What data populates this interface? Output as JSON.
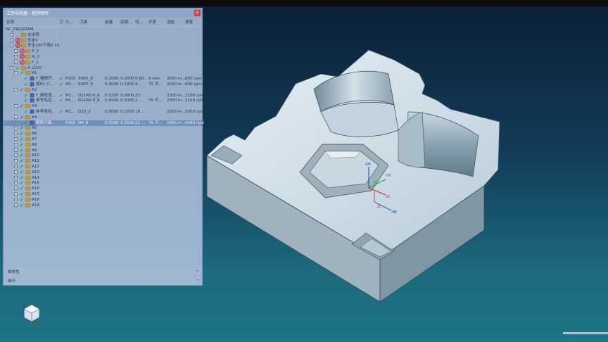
{
  "panel": {
    "title": "工序导航器 - 程序顺序",
    "columns": [
      "名称",
      "刀",
      "几...",
      "刀具",
      "余量",
      "底面...",
      "切...",
      "步距",
      "进给",
      "速度"
    ],
    "rows": [
      {
        "name": "NC_PROGRAM",
        "indent": 0,
        "icon": "none"
      },
      {
        "name": "未用项",
        "indent": 1,
        "icon": "folder"
      },
      {
        "name": "安全5",
        "indent": 1,
        "icon": "folder-blocked"
      },
      {
        "name": "安全100下降0.15",
        "indent": 1,
        "icon": "folder-blocked"
      },
      {
        "name": "R_2",
        "indent": 2,
        "icon": "folder-blocked"
      },
      {
        "name": "M_2",
        "indent": 2,
        "icon": "folder-blocked"
      },
      {
        "name": "F_2",
        "indent": 2,
        "icon": "folder-blocked"
      },
      {
        "name": "A_LV10",
        "indent": 1,
        "icon": "folder-check"
      },
      {
        "name": "A1",
        "indent": 2,
        "icon": "folder-check"
      },
      {
        "name": "F_粗精开...",
        "indent": 3,
        "icon": "op",
        "check": "✔",
        "tool": "P100",
        "geom": "50R5_R",
        "stock": "0.2000",
        "floor": "0.0000",
        "cut": "0.60...",
        "step": "6 mm",
        "feed": "2000 m...",
        "speed": "800 rpm"
      },
      {
        "name": "精R2_C...",
        "indent": 3,
        "icon": "op",
        "check": "✔",
        "tool": "M1...",
        "geom": "50R5_R",
        "stock": "0.4000",
        "floor": "0.1500",
        "cut": "4...",
        "step": "75 平...",
        "feed": "2000 m...",
        "speed": "800 rpm"
      },
      {
        "name": "A2",
        "indent": 2,
        "icon": "folder-check"
      },
      {
        "name": "F_精铣差...",
        "indent": 3,
        "icon": "op",
        "check": "✔",
        "tool": "M1...",
        "geom": "D21R0.8_R",
        "stock": "0.1200",
        "floor": "0.0000",
        "cut": "23 ...",
        "step": "",
        "feed": "2300 m...",
        "speed": "2100 rpm"
      },
      {
        "name": "参考毛坯...",
        "indent": 3,
        "icon": "op",
        "check": "✔",
        "tool": "M1...",
        "geom": "D21R0.8_R",
        "stock": "0.4500",
        "floor": "0.2000",
        "cut": "2 ...",
        "step": "75 平...",
        "feed": "2300 m...",
        "speed": "2100 rpm"
      },
      {
        "name": "A3",
        "indent": 2,
        "icon": "folder-check"
      },
      {
        "name": "参考毛坯...",
        "indent": 3,
        "icon": "op",
        "check": "✔",
        "tool": "M1...",
        "geom": "D10_S",
        "stock": "0.5000",
        "floor": "0.2300",
        "cut": "18 ...",
        "step": "",
        "feed": "2300 m...",
        "speed": "3000 rpm"
      },
      {
        "name": "A4",
        "indent": 2,
        "icon": "folder-check"
      },
      {
        "name": "精修刀面...",
        "indent": 3,
        "icon": "op",
        "check": "",
        "tool": "P100",
        "geom": "D4_R",
        "stock": "0.5000",
        "floor": "0.2500",
        "cut": "21 ...",
        "step": "75 平...",
        "feed": "1900 m...",
        "speed": "4500 rpm",
        "selected": true
      },
      {
        "name": "A5",
        "indent": 2,
        "icon": "folder-check"
      },
      {
        "name": "A6",
        "indent": 2,
        "icon": "folder-check"
      },
      {
        "name": "A7",
        "indent": 2,
        "icon": "folder-check"
      },
      {
        "name": "A8",
        "indent": 2,
        "icon": "folder-check"
      },
      {
        "name": "A9",
        "indent": 2,
        "icon": "folder-check"
      },
      {
        "name": "A10",
        "indent": 2,
        "icon": "folder-check"
      },
      {
        "name": "A11",
        "indent": 2,
        "icon": "folder-check"
      },
      {
        "name": "A12",
        "indent": 2,
        "icon": "folder-check"
      },
      {
        "name": "A13",
        "indent": 2,
        "icon": "folder-check"
      },
      {
        "name": "A14",
        "indent": 2,
        "icon": "folder-check"
      },
      {
        "name": "A15",
        "indent": 2,
        "icon": "folder-check"
      },
      {
        "name": "A16",
        "indent": 2,
        "icon": "folder-check"
      },
      {
        "name": "A17",
        "indent": 2,
        "icon": "folder-check"
      },
      {
        "name": "A18",
        "indent": 2,
        "icon": "folder-check"
      },
      {
        "name": "A19",
        "indent": 2,
        "icon": "folder-check"
      }
    ],
    "sections": [
      {
        "label": "相依性",
        "chevron": "^"
      },
      {
        "label": "细节",
        "chevron": "^"
      }
    ]
  },
  "csys_labels": {
    "zm": "ZM",
    "xm": "XM",
    "yc": "YC",
    "xc": "XC",
    "zc": "ZC",
    "ym": "YM"
  },
  "colors": {
    "check": "#1fa33a",
    "blocked": "#d02a24",
    "folder": "#c99a2e",
    "selection": "#6f8fbf"
  }
}
